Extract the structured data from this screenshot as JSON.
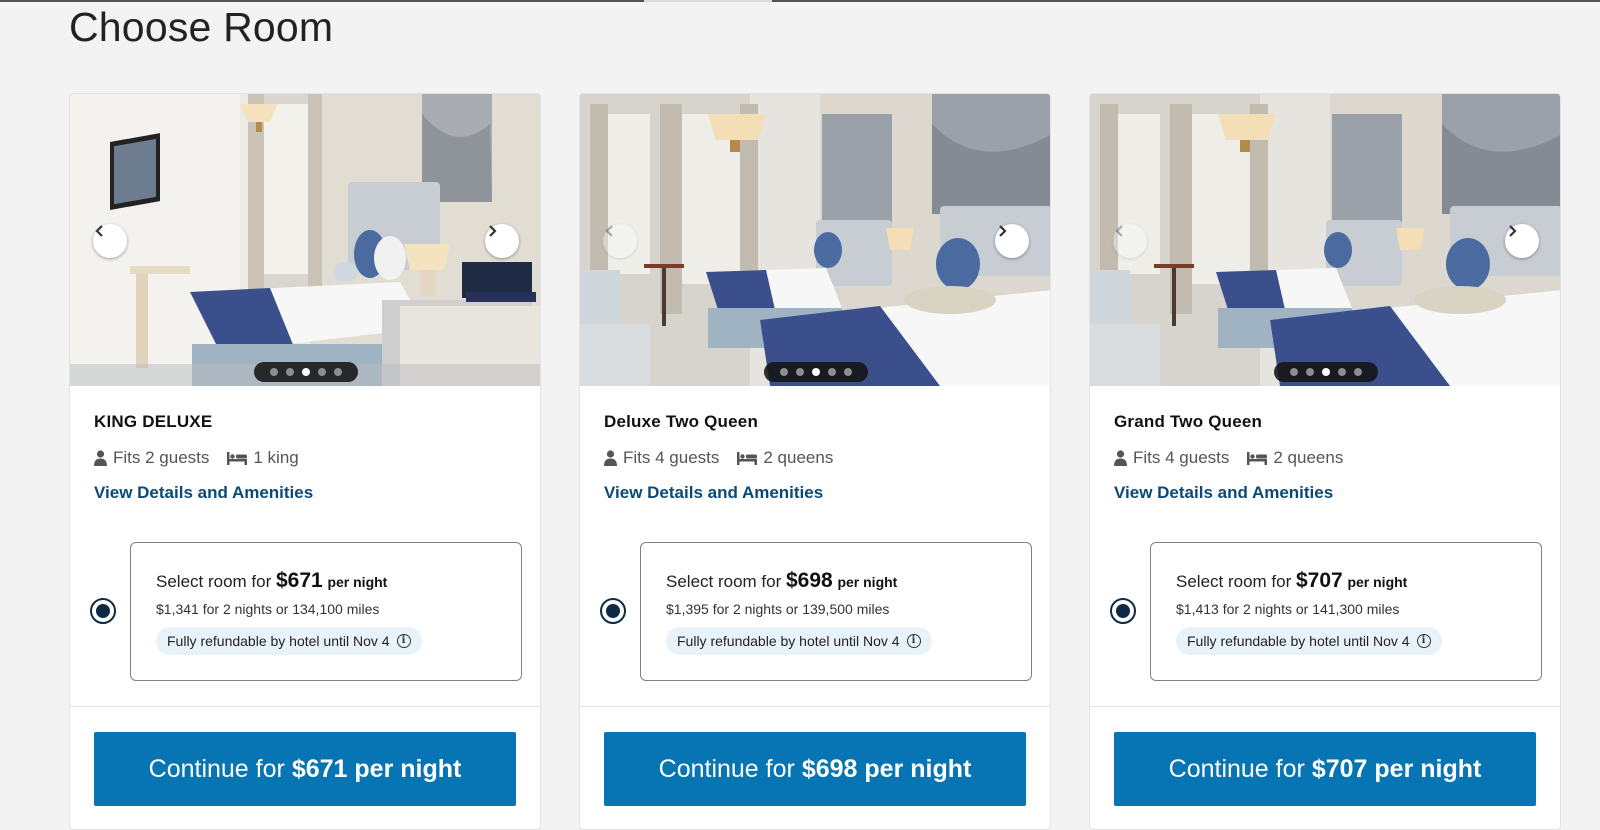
{
  "page_title": "Choose Room",
  "rooms": [
    {
      "name": "KING DELUXE",
      "guests": "Fits 2 guests",
      "beds": "1 king",
      "details_link": "View Details and Amenities",
      "select_prefix": "Select room for",
      "nightly_price": "$671",
      "per_night": "per night",
      "total": "$1,341 for 2 nights or 134,100 miles",
      "refund": "Fully refundable by hotel until Nov 4",
      "continue_prefix": "Continue for",
      "continue_price": "$671 per night",
      "slide_count": 5,
      "active_slide": 3,
      "selected": true
    },
    {
      "name": "Deluxe Two Queen",
      "guests": "Fits 4 guests",
      "beds": "2 queens",
      "details_link": "View Details and Amenities",
      "select_prefix": "Select room for",
      "nightly_price": "$698",
      "per_night": "per night",
      "total": "$1,395 for 2 nights or 139,500 miles",
      "refund": "Fully refundable by hotel until Nov 4",
      "continue_prefix": "Continue for",
      "continue_price": "$698 per night",
      "slide_count": 5,
      "active_slide": 3,
      "selected": true
    },
    {
      "name": "Grand Two Queen",
      "guests": "Fits 4 guests",
      "beds": "2 queens",
      "details_link": "View Details and Amenities",
      "select_prefix": "Select room for",
      "nightly_price": "$707",
      "per_night": "per night",
      "total": "$1,413 for 2 nights or 141,300 miles",
      "refund": "Fully refundable by hotel until Nov 4",
      "continue_prefix": "Continue for",
      "continue_price": "$707 per night",
      "slide_count": 5,
      "active_slide": 3,
      "selected": true
    }
  ],
  "colors": {
    "accent_button": "#0774b3",
    "link": "#0b4a78",
    "radio": "#0d2b45",
    "refund_chip_bg": "#e8f2f9"
  },
  "icons": {
    "guests": "person-icon",
    "beds": "bed-icon",
    "info": "info-icon",
    "prev": "chevron-left-icon",
    "next": "chevron-right-icon"
  }
}
